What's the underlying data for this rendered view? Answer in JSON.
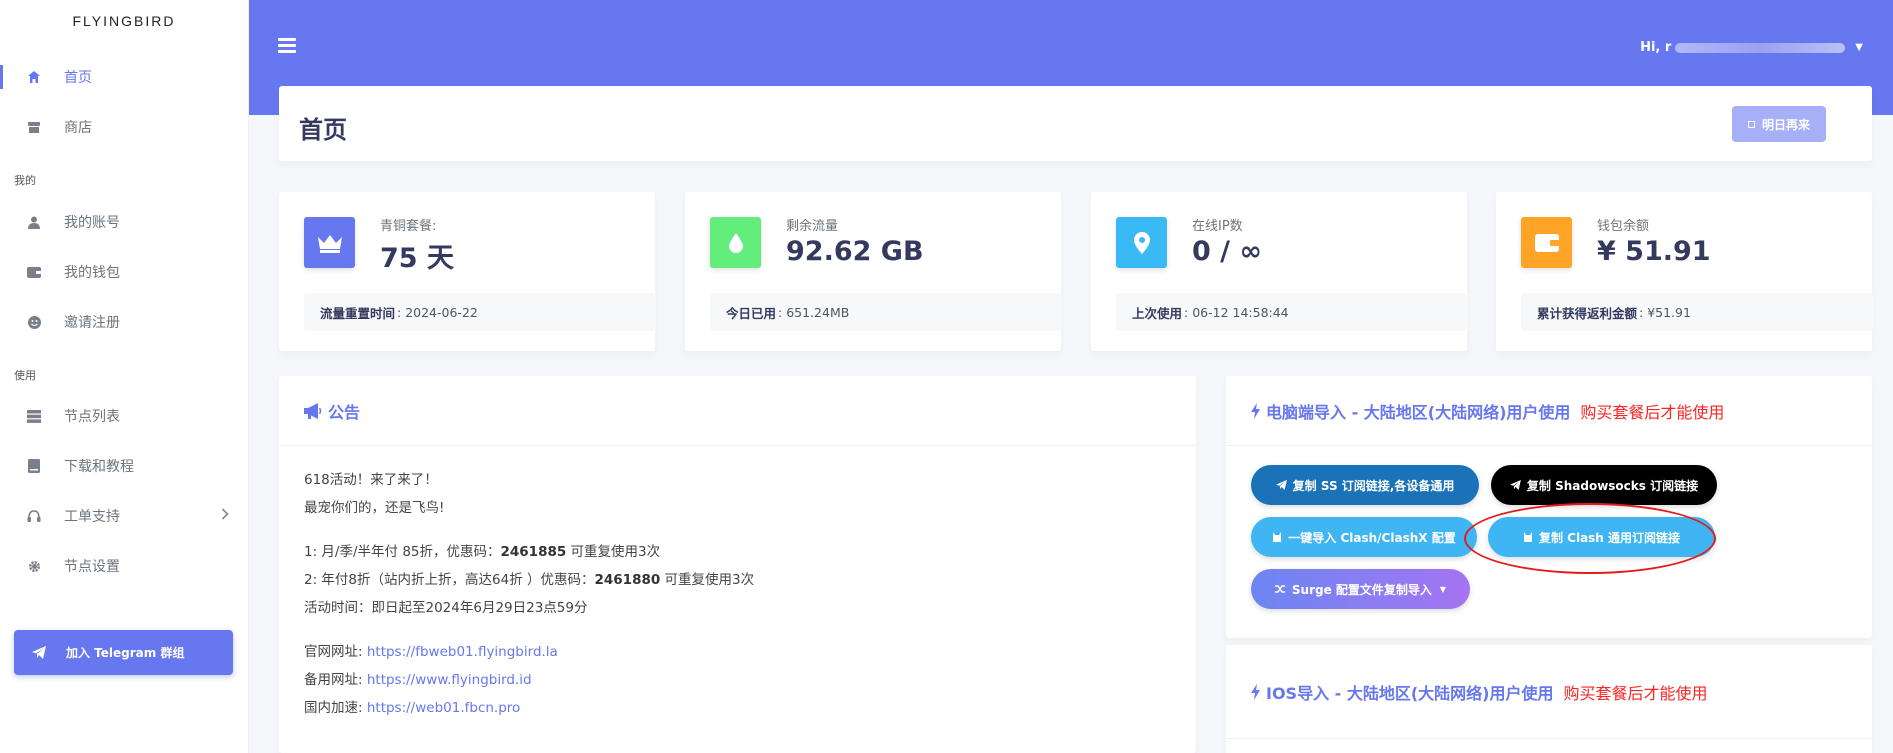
{
  "brand": "FLYINGBIRD",
  "sidebar": {
    "items": [
      {
        "label": "首页",
        "icon": "home-icon"
      },
      {
        "label": "商店",
        "icon": "store-icon"
      },
      {
        "label": "我的账号",
        "icon": "user-icon"
      },
      {
        "label": "我的钱包",
        "icon": "wallet-icon"
      },
      {
        "label": "邀请注册",
        "icon": "smile-icon"
      },
      {
        "label": "节点列表",
        "icon": "server-icon"
      },
      {
        "label": "下载和教程",
        "icon": "book-icon"
      },
      {
        "label": "工单支持",
        "icon": "headset-icon"
      },
      {
        "label": "节点设置",
        "icon": "gear-icon"
      }
    ],
    "section_mine": "我的",
    "section_use": "使用",
    "telegram_label": "加入 Telegram 群组"
  },
  "topbar": {
    "greeting": "Hi, r"
  },
  "header": {
    "title": "首页",
    "checkin_label": "明日再来"
  },
  "stats": [
    {
      "label": "青铜套餐:",
      "value": "75 天",
      "foot_key": "流量重置时间",
      "foot_value": ": 2024-06-22",
      "color": "#6777ef",
      "icon": "crown-icon"
    },
    {
      "label": "剩余流量",
      "value": "92.62 GB",
      "foot_key": "今日已用",
      "foot_value": ": 651.24MB",
      "color": "#63ed7a",
      "icon": "drop-icon"
    },
    {
      "label": "在线IP数",
      "value": "0 / ∞",
      "foot_key": "上次使用",
      "foot_value": ": 06-12 14:58:44",
      "color": "#3abaf4",
      "icon": "location-icon"
    },
    {
      "label": "钱包余额",
      "value": "¥ 51.91",
      "foot_key": "累计获得返利金额",
      "foot_value": ": ¥51.91",
      "color": "#ffa426",
      "icon": "wallet-icon"
    }
  ],
  "notice": {
    "title": "公告",
    "line1": "618活动！来了来了！",
    "line2": "最宠你们的，还是飞鸟!",
    "promo1_pre": "1: 月/季/半年付 85折，优惠码：",
    "promo1_code": "2461885",
    "promo1_post": " 可重复使用3次",
    "promo2_pre": "2: 年付8折（站内折上折，高达64折 ）优惠码：",
    "promo2_code": "2461880",
    "promo2_post": " 可重复使用3次",
    "time": "活动时间：即日起至2024年6月29日23点59分",
    "site_label": "官网网址: ",
    "site_url": "https://fbweb01.flyingbird.la",
    "backup_label": "备用网址: ",
    "backup_url": "https://www.flyingbird.id",
    "cn_label": "国内加速: ",
    "cn_url": "https://web01.fbcn.pro"
  },
  "pc_import": {
    "title": "电脑端导入 - 大陆地区(大陆网络)用户使用",
    "warning": "购买套餐后才能使用",
    "buttons": [
      {
        "label": "复制 SS 订阅链接,各设备通用",
        "color": "#1a73b8"
      },
      {
        "label": "复制 Shadowsocks 订阅链接",
        "color": "#000000"
      },
      {
        "label": "一键导入 Clash/ClashX 配置",
        "color": "#3fb5f3"
      },
      {
        "label": "复制 Clash 通用订阅链接",
        "color": "#3fb5f3"
      },
      {
        "label": "Surge 配置文件复制导入",
        "color": "#8e7cf4"
      }
    ]
  },
  "ios_import": {
    "title": "IOS导入 - 大陆地区(大陆网络)用户使用",
    "warning": "购买套餐后才能使用"
  }
}
